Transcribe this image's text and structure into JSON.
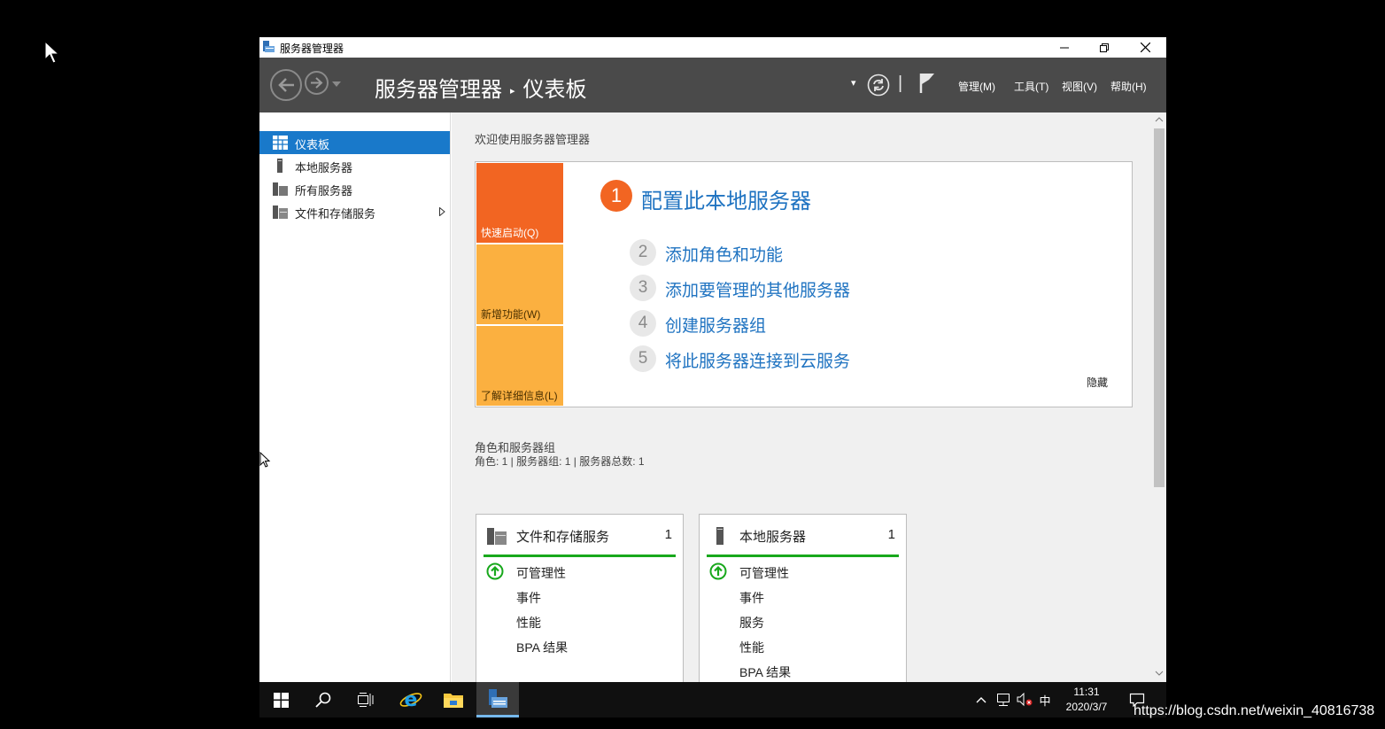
{
  "window": {
    "title": "服务器管理器"
  },
  "header": {
    "breadcrumb_root": "服务器管理器",
    "breadcrumb_separator": "▸",
    "breadcrumb_current": "仪表板",
    "dropdown_glyph": "▾",
    "divider": "|",
    "menus": [
      "管理(M)",
      "工具(T)",
      "视图(V)",
      "帮助(H)"
    ]
  },
  "sidebar": {
    "items": [
      {
        "label": "仪表板",
        "icon": "dashboard-icon",
        "active": true
      },
      {
        "label": "本地服务器",
        "icon": "server-icon"
      },
      {
        "label": "所有服务器",
        "icon": "servers-icon"
      },
      {
        "label": "文件和存储服务",
        "icon": "file-storage-icon",
        "has_submenu": true
      }
    ]
  },
  "welcome": {
    "title": "欢迎使用服务器管理器",
    "tiles": [
      "快速启动(Q)",
      "新增功能(W)",
      "了解详细信息(L)"
    ],
    "tile_colors": [
      "#f26522",
      "#fbb040",
      "#fbb040"
    ],
    "step1": {
      "number": "1",
      "text": "配置此本地服务器"
    },
    "steps": [
      {
        "number": "2",
        "text": "添加角色和功能"
      },
      {
        "number": "3",
        "text": "添加要管理的其他服务器"
      },
      {
        "number": "4",
        "text": "创建服务器组"
      },
      {
        "number": "5",
        "text": "将此服务器连接到云服务"
      }
    ],
    "hide_label": "隐藏"
  },
  "roles": {
    "title": "角色和服务器组",
    "summary": "角色: 1 | 服务器组: 1 | 服务器总数: 1",
    "cards": [
      {
        "title": "文件和存储服务",
        "count": "1",
        "icon": "file-storage-icon",
        "rows": [
          "可管理性",
          "事件",
          "性能",
          "BPA 结果"
        ]
      },
      {
        "title": "本地服务器",
        "count": "1",
        "icon": "server-icon",
        "rows": [
          "可管理性",
          "事件",
          "服务",
          "性能",
          "BPA 结果"
        ]
      }
    ]
  },
  "taskbar": {
    "time": "11:31",
    "date": "2020/3/7",
    "ime": "中",
    "apps": [
      "start-icon",
      "search-icon",
      "task-view-icon",
      "ie-icon",
      "file-explorer-icon",
      "server-manager-icon"
    ]
  },
  "watermark": "https://blog.csdn.net/weixin_40816738",
  "colors": {
    "accent": "#1979ca",
    "link": "#1f73c1",
    "header_bg": "#4a4a4a",
    "status_ok": "#18a81c"
  }
}
